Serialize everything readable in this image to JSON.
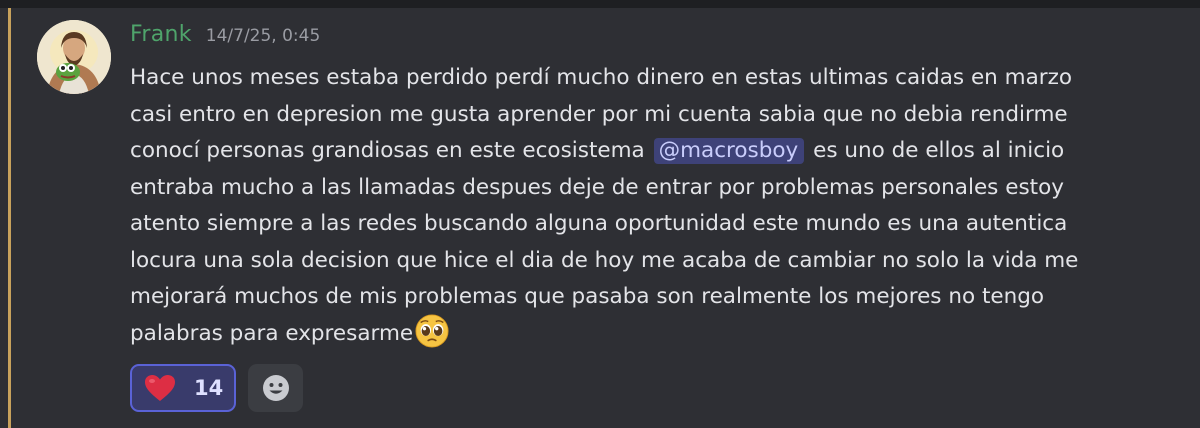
{
  "message": {
    "author": "Frank",
    "timestamp": "14/7/25, 0:45",
    "lines": [
      "Hace unos meses estaba perdido perdí mucho dinero en estas ultimas caidas en marzo",
      "casi entro en depresion me gusta aprender por mi cuenta sabia que no debia rendirme",
      "entraba mucho a las llamadas despues deje de entrar por problemas personales estoy",
      "atento siempre a las redes buscando alguna oportunidad este mundo es una autentica",
      "locura una sola decision que hice el dia de hoy me acaba de cambiar no solo la vida me",
      "mejorará muchos de mis problemas que pasaba son realmente los mejores no tengo"
    ],
    "mention_line": {
      "before": "conocí personas grandiosas en este ecosistema",
      "mention": "@macrosboy",
      "after": "es uno de ellos al inicio"
    },
    "last_line": "palabras para expresarme",
    "last_line_emoji": "pleading-face-emoji"
  },
  "reactions": [
    {
      "emoji": "red-heart-icon",
      "count": "14",
      "selected": true
    }
  ],
  "add_reaction": {
    "icon": "smiley-add-reaction-icon"
  },
  "colors": {
    "background": "#2e2f34",
    "username": "#4fa46b",
    "highlight_bar": "#c8a25c",
    "mention_bg": "#3e4278",
    "reaction_border": "#5a62d6"
  }
}
